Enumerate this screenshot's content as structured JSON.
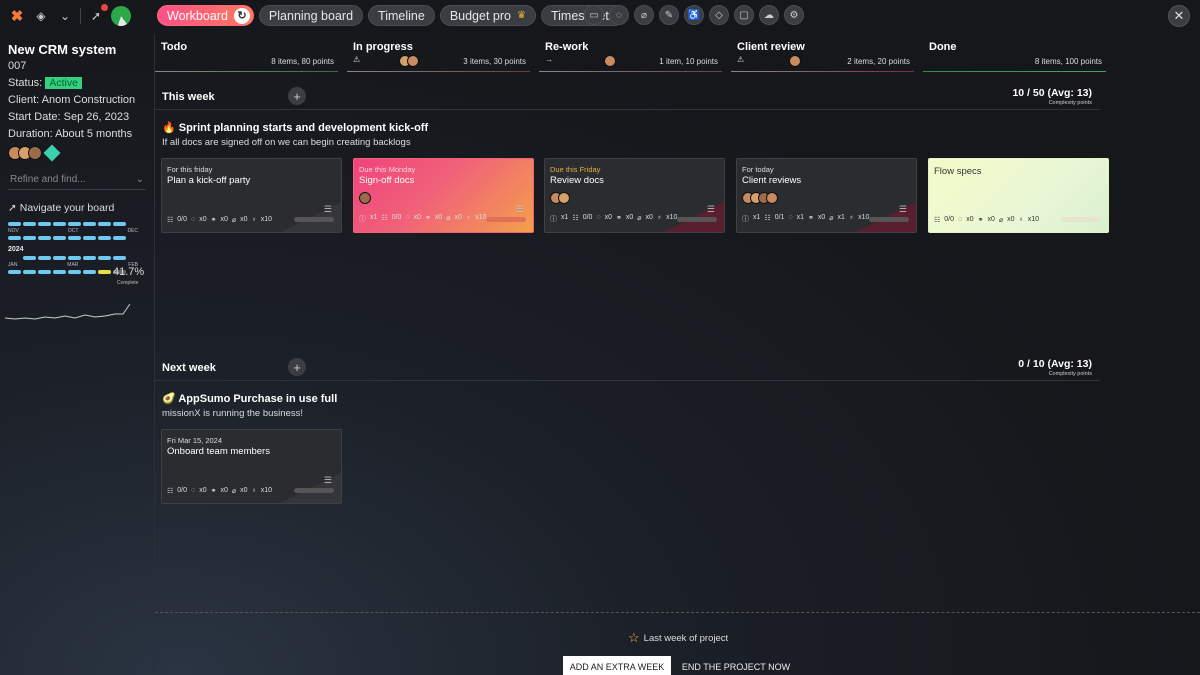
{
  "tabs": [
    {
      "label": "Workboard"
    },
    {
      "label": "Planning board"
    },
    {
      "label": "Timeline"
    },
    {
      "label": "Budget pro"
    },
    {
      "label": "Timesheets"
    }
  ],
  "project": {
    "title": "New CRM system",
    "code": "007",
    "status_label": "Status:",
    "status": "Active",
    "client": "Client: Anom Construction",
    "start": "Start Date: Sep 26, 2023",
    "duration": "Duration: About 5 months"
  },
  "sidebar": {
    "search_placeholder": "Refine and find...",
    "nav_title": "Navigate your board",
    "months_2023": [
      "NOV",
      "OCT",
      "DEC"
    ],
    "year": "2024",
    "months_2024": [
      "JAN",
      "MAR",
      "FEB"
    ],
    "progress_value": "41.7%",
    "progress_label": "Complete"
  },
  "columns": [
    {
      "name": "Todo",
      "meta": "8 items, 80 points"
    },
    {
      "name": "In progress",
      "meta": "3 items, 30 points",
      "icon": "⚠"
    },
    {
      "name": "Re-work",
      "meta": "1 item, 10 points",
      "icon": "→"
    },
    {
      "name": "Client review",
      "meta": "2 items, 20 points",
      "icon": "⚠"
    },
    {
      "name": "Done",
      "meta": "8 items, 100 points"
    }
  ],
  "this_week": {
    "title": "This week",
    "stat": "10 / 50 (Avg: 13)",
    "stat_sub": "Complexity points",
    "sprint_title": "🔥 Sprint planning starts and development kick-off",
    "sprint_desc": "If all docs are signed off on we can begin creating backlogs",
    "cards": [
      {
        "due": "For this friday",
        "title": "Plan a kick-off party",
        "s1": "0/0",
        "s2": "x0",
        "s3": "x0",
        "s4": "x0",
        "s5": "x10"
      },
      {
        "due": "Due this Monday",
        "title": "Sign-off docs",
        "s0": "x1",
        "s1": "0/0",
        "s2": "x0",
        "s3": "x0",
        "s4": "x0",
        "s5": "x10"
      },
      {
        "due": "Due this Friday",
        "title": "Review docs",
        "s0": "x1",
        "s1": "0/0",
        "s2": "x0",
        "s3": "x0",
        "s4": "x0",
        "s5": "x10"
      },
      {
        "due": "For today",
        "title": "Client reviews",
        "s0": "x1",
        "s1": "0/1",
        "s2": "x1",
        "s3": "x0",
        "s4": "x1",
        "s5": "x10"
      },
      {
        "title": "Flow specs",
        "s1": "0/0",
        "s2": "x0",
        "s3": "x0",
        "s4": "x0",
        "s5": "x10"
      }
    ]
  },
  "next_week": {
    "title": "Next week",
    "stat": "0 / 10 (Avg: 13)",
    "stat_sub": "Complexity points",
    "sprint_title": "🥑 AppSumo Purchase in use full",
    "sprint_desc": "missionX is running the business!",
    "cards": [
      {
        "due": "Fri Mar 15, 2024",
        "title": "Onboard team members",
        "s1": "0/0",
        "s2": "x0",
        "s3": "x0",
        "s4": "x0",
        "s5": "x10"
      }
    ]
  },
  "footer": {
    "last_week": "Last week of project",
    "add_extra": "ADD AN EXTRA WEEK",
    "end_project": "END THE PROJECT NOW"
  }
}
